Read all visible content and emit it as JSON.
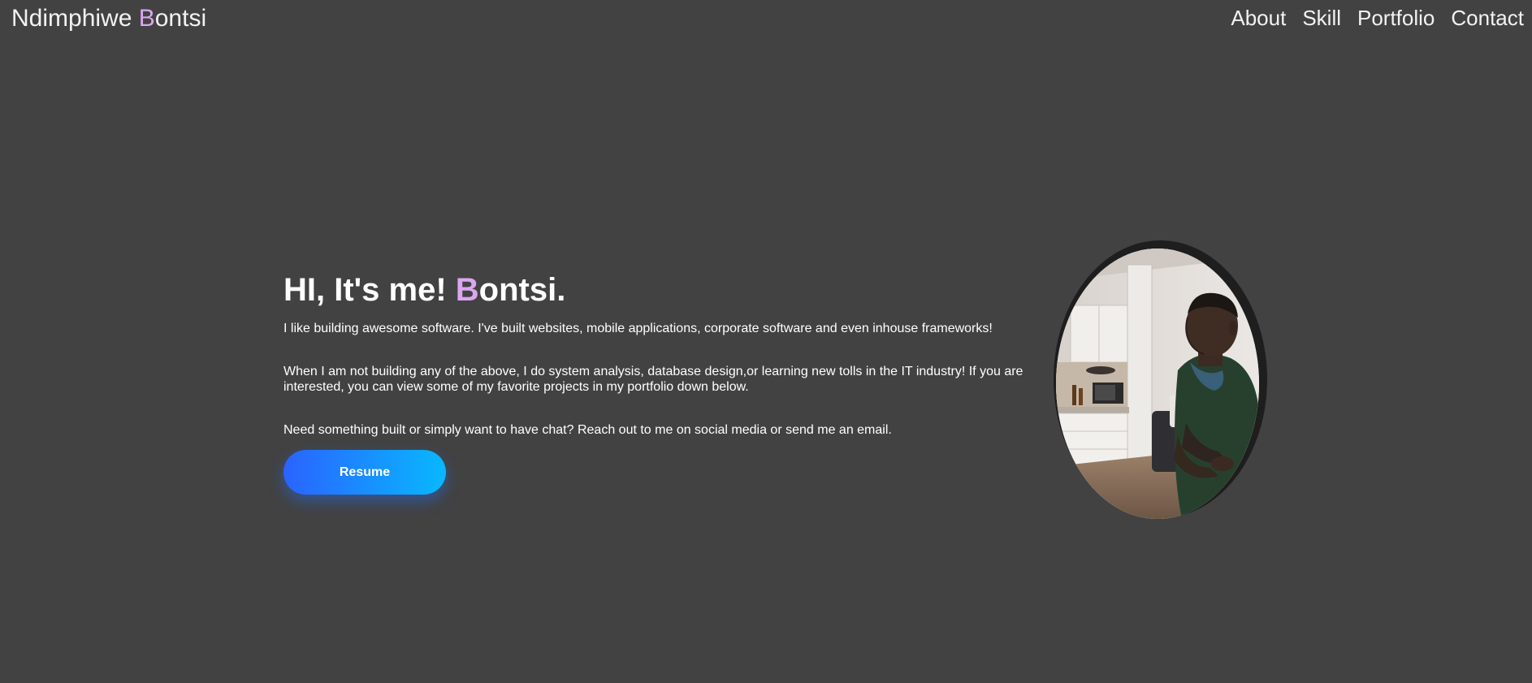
{
  "header": {
    "brand_first": "Ndimphiwe ",
    "brand_initial": "B",
    "brand_rest": "ontsi",
    "nav": [
      "About",
      "Skill",
      "Portfolio",
      "Contact"
    ]
  },
  "hero": {
    "greeting": "HI, It's me! ",
    "name_initial": "B",
    "name_rest": "ontsi.",
    "paragraphs": [
      "I like building awesome software. I've built websites, mobile applications, corporate software and even inhouse frameworks!",
      "When I am not building any of the above, I do system analysis, database design,or learning new tolls in the IT industry! If you are interested, you can view some of my favorite projects in my portfolio down below.",
      "Need something built or simply want to have chat? Reach out to me on social media or send me an email."
    ],
    "resume_label": "Resume"
  },
  "colors": {
    "background": "#424242",
    "accent": "#dba6f0",
    "button_gradient_start": "#2a63ff",
    "button_gradient_end": "#08b8ff"
  }
}
